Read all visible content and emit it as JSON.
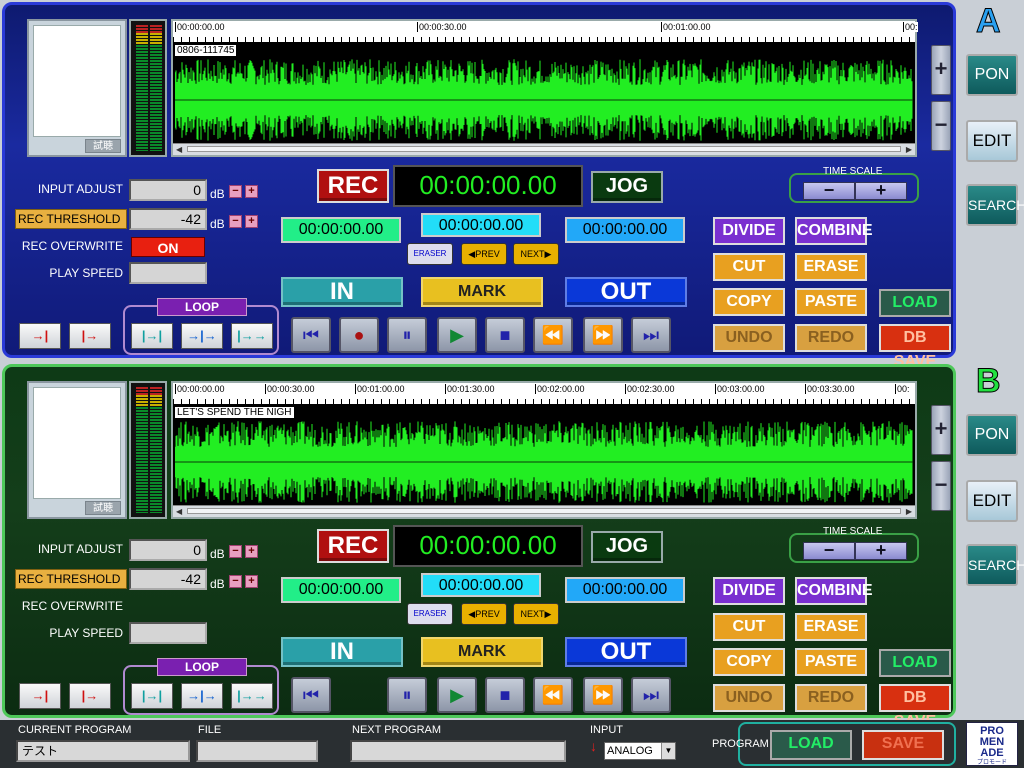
{
  "deckA": {
    "letter": "A",
    "thumb_label": "試聴",
    "ruler_ticks": [
      "00:00:00.00",
      "00:00:30.00",
      "00:01:00.00",
      "00:"
    ],
    "track_name": "0806-111745",
    "input_adjust_label": "INPUT ADJUST",
    "input_adjust_value": "0",
    "db": "dB",
    "rec_threshold_label": "REC THRESHOLD",
    "rec_threshold_value": "-42",
    "rec_overwrite_label": "REC OVERWRITE",
    "rec_overwrite_state": "ON",
    "play_speed_label": "PLAY SPEED",
    "rec": "REC",
    "timecode": "00:00:00.00",
    "jog": "JOG",
    "time_scale": "TIME SCALE",
    "in_time": "00:00:00.00",
    "mark_time": "00:00:00.00",
    "out_time": "00:00:00.00",
    "eraser": "ERASER",
    "prev": "PREV",
    "next": "NEXT",
    "in": "IN",
    "mark": "MARK",
    "out": "OUT",
    "loop": "LOOP",
    "edit": [
      "DIVIDE",
      "COMBINE",
      "CUT",
      "ERASE",
      "COPY",
      "PASTE",
      "UNDO",
      "REDO"
    ],
    "load": "LOAD",
    "dbsave": "DB SAVE"
  },
  "deckB": {
    "letter": "B",
    "thumb_label": "試聴",
    "ruler_ticks": [
      "00:00:00.00",
      "00:00:30.00",
      "00:01:00.00",
      "00:01:30.00",
      "00:02:00.00",
      "00:02:30.00",
      "00:03:00.00",
      "00:03:30.00",
      "00:"
    ],
    "track_name": "LET'S SPEND THE NIGH",
    "input_adjust_label": "INPUT ADJUST",
    "input_adjust_value": "0",
    "db": "dB",
    "rec_threshold_label": "REC THRESHOLD",
    "rec_threshold_value": "-42",
    "rec_overwrite_label": "REC OVERWRITE",
    "play_speed_label": "PLAY SPEED",
    "rec": "REC",
    "timecode": "00:00:00.00",
    "jog": "JOG",
    "time_scale": "TIME SCALE",
    "in_time": "00:00:00.00",
    "mark_time": "00:00:00.00",
    "out_time": "00:00:00.00",
    "eraser": "ERASER",
    "prev": "PREV",
    "next": "NEXT",
    "in": "IN",
    "mark": "MARK",
    "out": "OUT",
    "loop": "LOOP",
    "edit": [
      "DIVIDE",
      "COMBINE",
      "CUT",
      "ERASE",
      "COPY",
      "PASTE",
      "UNDO",
      "REDO"
    ],
    "load": "LOAD",
    "dbsave": "DB SAVE"
  },
  "side": {
    "pon": "PON",
    "edit": "EDIT",
    "search": "SEARCH"
  },
  "footer": {
    "current_program_label": "CURRENT PROGRAM",
    "current_program_value": "テスト",
    "file_label": "FILE",
    "file_value": "",
    "next_program_label": "NEXT PROGRAM",
    "next_program_value": "",
    "input_label": "INPUT",
    "input_value": "ANALOG",
    "program_label": "PROGRAM",
    "load": "LOAD",
    "save": "SAVE",
    "logo_text": "PRO MEN ADE",
    "logo_sub": "プロモード"
  },
  "colors": {
    "deckA_letter": "#2aa0f0",
    "deckB_letter": "#22e040",
    "wave": "#22ee22"
  }
}
